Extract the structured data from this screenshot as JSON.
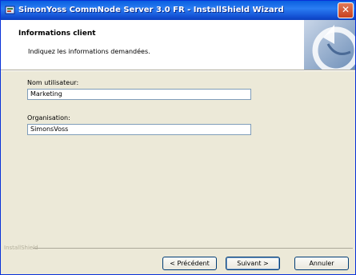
{
  "window": {
    "title": "SimonYoss CommNode Server 3.0 FR - InstallShield Wizard",
    "close_glyph": "✕"
  },
  "header": {
    "title": "Informations client",
    "subtitle": "Indiquez les informations demandées."
  },
  "form": {
    "username": {
      "label": "Nom utilisateur:",
      "value": "Marketing"
    },
    "organization": {
      "label": "Organisation:",
      "value": "SimonsVoss"
    }
  },
  "footer": {
    "brand": "InstallShield"
  },
  "buttons": {
    "back": "< Précédent",
    "next": "Suivant >",
    "cancel": "Annuler"
  },
  "colors": {
    "titlebar": "#1554d6",
    "dialog_bg": "#ece9d8",
    "header_bg": "#ffffff",
    "input_border": "#7f9db9"
  }
}
